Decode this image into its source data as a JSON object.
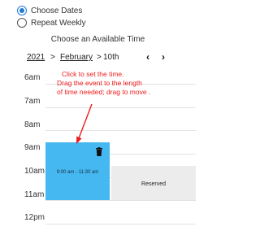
{
  "mode": {
    "options": [
      {
        "label": "Choose Dates",
        "checked": true
      },
      {
        "label": "Repeat Weekly",
        "checked": false
      }
    ]
  },
  "title": "Choose an Available Time",
  "nav": {
    "year": "2021",
    "sep1": ">",
    "month": "February",
    "sep2": ">",
    "day": "10th",
    "prev": "‹",
    "next": "›"
  },
  "hours": [
    "6am",
    "7am",
    "8am",
    "9am",
    "10am",
    "11am",
    "12pm"
  ],
  "event": {
    "time": "9:00 am - 11:30 am",
    "icon": "trash-icon",
    "color": "#45b8f2"
  },
  "reserved": {
    "label": "Reserved"
  },
  "annotation": {
    "lines": [
      "Click to set the time.",
      "Drag the event to the length",
      "of time needed; drag to move ."
    ],
    "color": "#f01b1b"
  },
  "colors": {
    "accent": "#1e7bd6",
    "reserved_bg": "#ececec"
  }
}
